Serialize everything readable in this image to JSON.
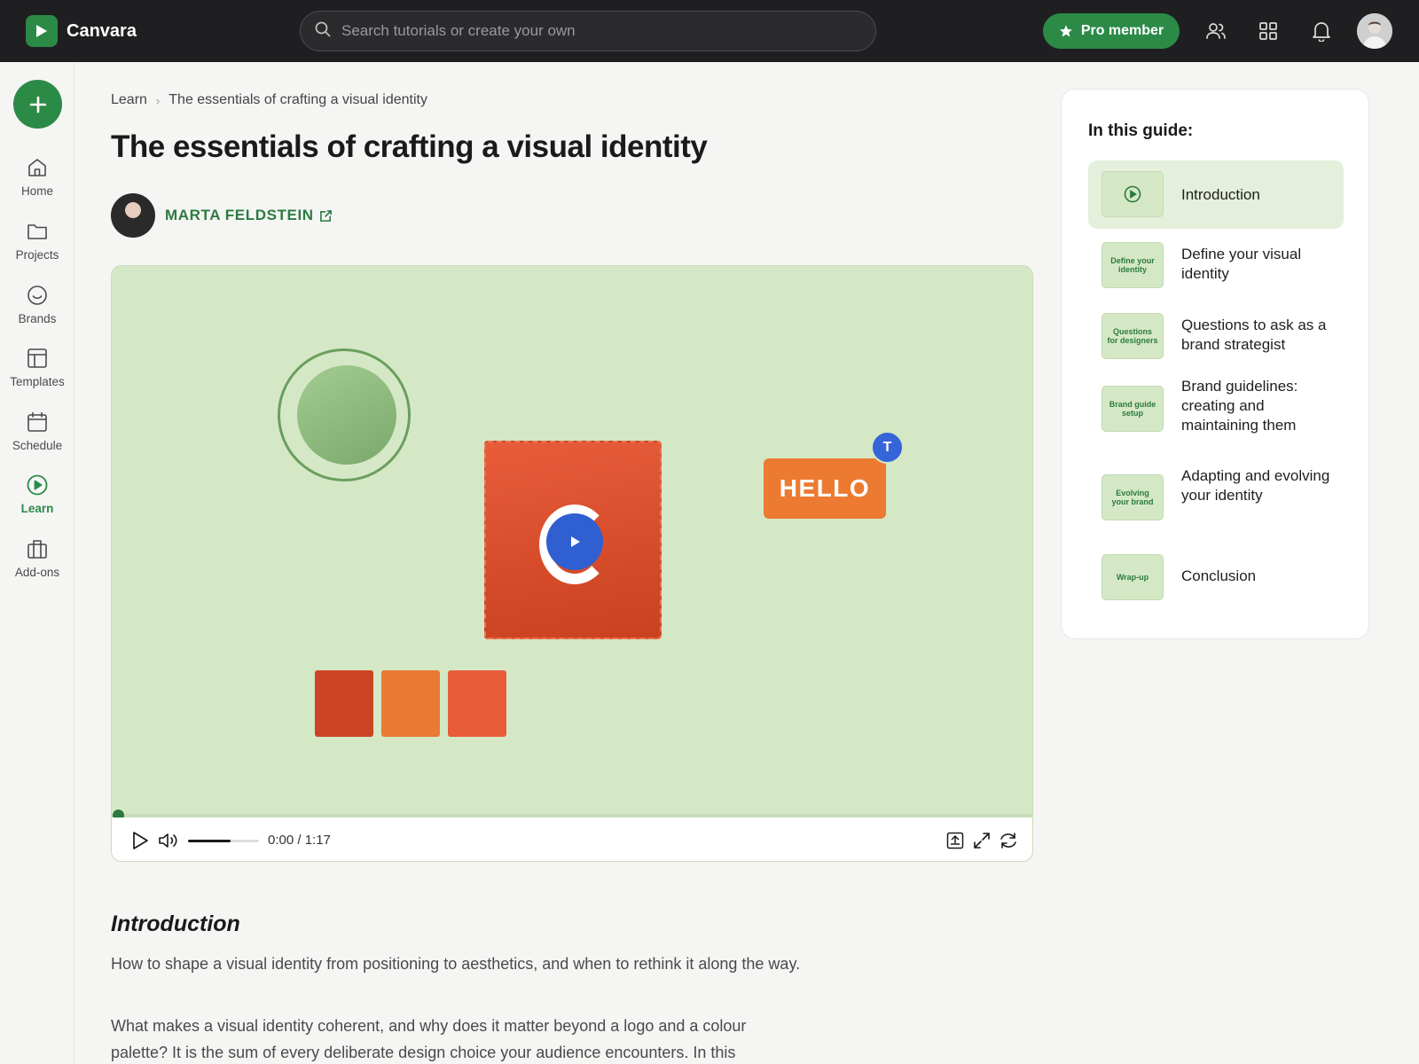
{
  "app": {
    "name": "Canvara"
  },
  "search": {
    "placeholder": "Search tutorials or create your own"
  },
  "header": {
    "pro_label": "Pro member"
  },
  "sidebar": {
    "items": [
      {
        "label": "Home",
        "icon": "home-icon"
      },
      {
        "label": "Projects",
        "icon": "folder-icon"
      },
      {
        "label": "Brands",
        "icon": "brand-icon"
      },
      {
        "label": "Templates",
        "icon": "template-icon"
      },
      {
        "label": "Schedule",
        "icon": "calendar-icon"
      },
      {
        "label": "Learn",
        "icon": "play-circle-icon",
        "active": true
      },
      {
        "label": "Add-ons",
        "icon": "briefcase-icon"
      }
    ]
  },
  "breadcrumb": {
    "root": "Learn",
    "current": "The essentials of crafting a visual identity"
  },
  "page": {
    "title": "The essentials of crafting a visual identity"
  },
  "author": {
    "name": "MARTA FELDSTEIN"
  },
  "video": {
    "hello_text": "HELLO",
    "badge_text": "T",
    "time_current": "0:00",
    "time_total": "1:17",
    "time_display": "0:00 / 1:17",
    "volume_level": 0.6,
    "progress": 0,
    "swatch_colors": [
      "#cc4424",
      "#e87a33",
      "#e85c3a"
    ]
  },
  "intro": {
    "heading": "Introduction",
    "p1": "How to shape a visual identity from positioning to aesthetics, and when to rethink it along the way.",
    "p2": "What makes a visual identity coherent, and why does it matter beyond a logo and a colour palette? It is the sum of every deliberate design choice your audience encounters. In this"
  },
  "guide": {
    "title": "In this guide:",
    "items": [
      {
        "thumb": "",
        "label": "Introduction",
        "active": true
      },
      {
        "thumb": "Define your identity",
        "label": "Define your visual identity"
      },
      {
        "thumb": "Questions for designers",
        "label": "Questions to ask as a brand strategist"
      },
      {
        "thumb": "Brand guide setup",
        "label": "Brand guidelines: creating and maintaining them"
      },
      {
        "thumb": "Evolving your brand",
        "label": "Adapting and evolving your identity"
      },
      {
        "thumb": "Wrap-up",
        "label": "Conclusion"
      }
    ]
  },
  "colors": {
    "accent": "#2c8a47",
    "topbar": "#1f1f21",
    "video_bg": "#d4e8c6"
  }
}
